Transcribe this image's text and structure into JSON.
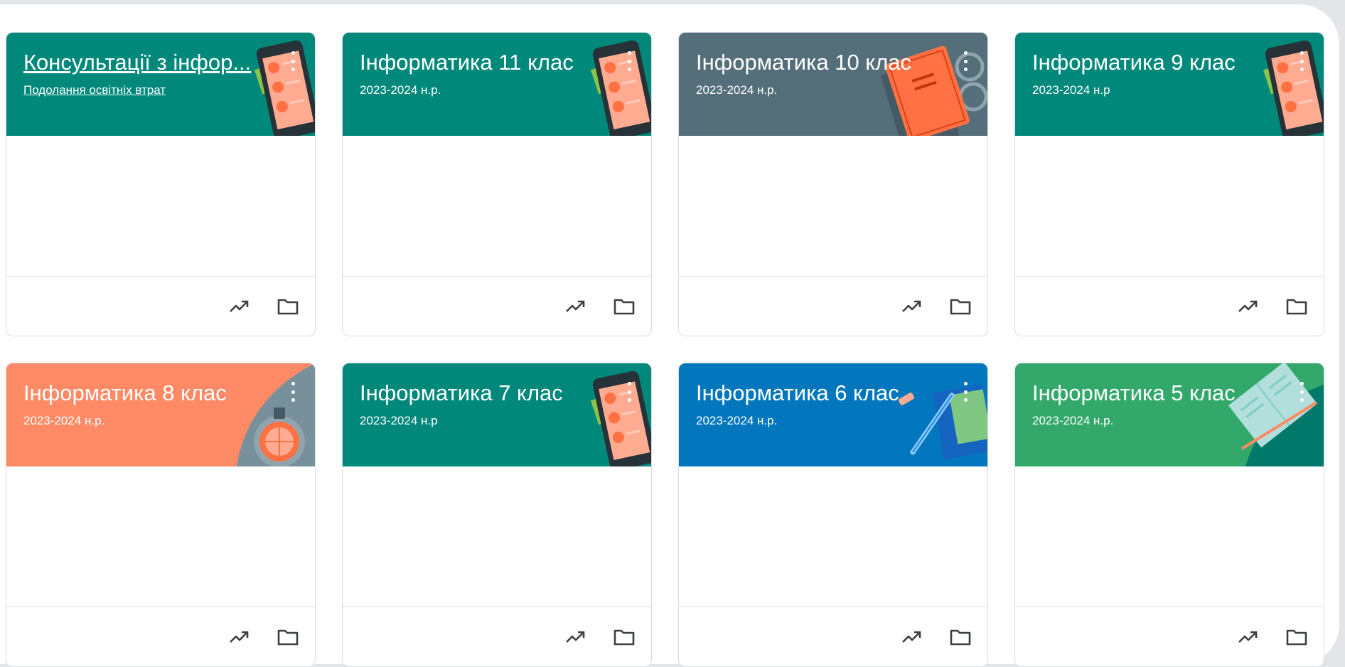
{
  "classes": [
    {
      "title": "Консультації з інфор...",
      "subtitle": "Подолання освітніх втрат",
      "color": "#00897b",
      "theme": "phone",
      "underline": true
    },
    {
      "title": "Інформатика 11 клас",
      "subtitle": "2023-2024 н.р.",
      "color": "#00897b",
      "theme": "phone",
      "underline": false
    },
    {
      "title": "Інформатика 10 клас",
      "subtitle": "2023-2024 н.р.",
      "color": "#546e7a",
      "theme": "book",
      "underline": false
    },
    {
      "title": "Інформатика 9 клас",
      "subtitle": "2023-2024 н.р",
      "color": "#00897b",
      "theme": "phone",
      "underline": false
    },
    {
      "title": "Інформатика 8 клас",
      "subtitle": "2023-2024 н.р.",
      "color": "#ff8a65",
      "theme": "orange",
      "underline": false
    },
    {
      "title": "Інформатика 7 клас",
      "subtitle": "2023-2024 н.р",
      "color": "#00897b",
      "theme": "phone",
      "underline": false
    },
    {
      "title": "Інформатика 6 клас",
      "subtitle": "2023-2024 н.р.",
      "color": "#0277bd",
      "theme": "pen",
      "underline": false
    },
    {
      "title": "Інформатика 5 клас",
      "subtitle": "2023-2024 н.р.",
      "color": "#33a86b",
      "theme": "notebook",
      "underline": false
    }
  ],
  "icons": {
    "menu": "more-vert-icon",
    "trend": "trending-up-icon",
    "folder": "folder-icon"
  }
}
